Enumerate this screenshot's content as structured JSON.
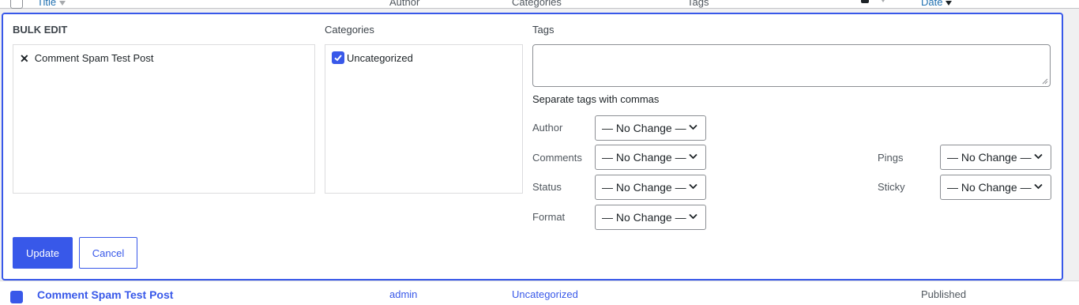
{
  "table_header": {
    "columns": {
      "title": "Title",
      "author": "Author",
      "categories": "Categories",
      "tags": "Tags",
      "date": "Date"
    }
  },
  "bulk_edit": {
    "heading": "BULK EDIT",
    "selected_posts": [
      "Comment Spam Test Post"
    ],
    "categories_label": "Categories",
    "categories": [
      {
        "label": "Uncategorized",
        "checked": true
      }
    ],
    "tags_label": "Tags",
    "tags_value": "",
    "tags_help": "Separate tags with commas",
    "fields": {
      "author": {
        "label": "Author",
        "value": "— No Change —"
      },
      "comments": {
        "label": "Comments",
        "value": "— No Change —"
      },
      "status": {
        "label": "Status",
        "value": "— No Change —"
      },
      "format": {
        "label": "Format",
        "value": "— No Change —"
      },
      "pings": {
        "label": "Pings",
        "value": "— No Change —"
      },
      "sticky": {
        "label": "Sticky",
        "value": "— No Change —"
      }
    },
    "update_label": "Update",
    "cancel_label": "Cancel"
  },
  "post_row": {
    "title": "Comment Spam Test Post",
    "author": "admin",
    "category": "Uncategorized",
    "status": "Published"
  },
  "colors": {
    "accent": "#3858e9",
    "border": "#dcdcde",
    "text": "#1d2327"
  }
}
